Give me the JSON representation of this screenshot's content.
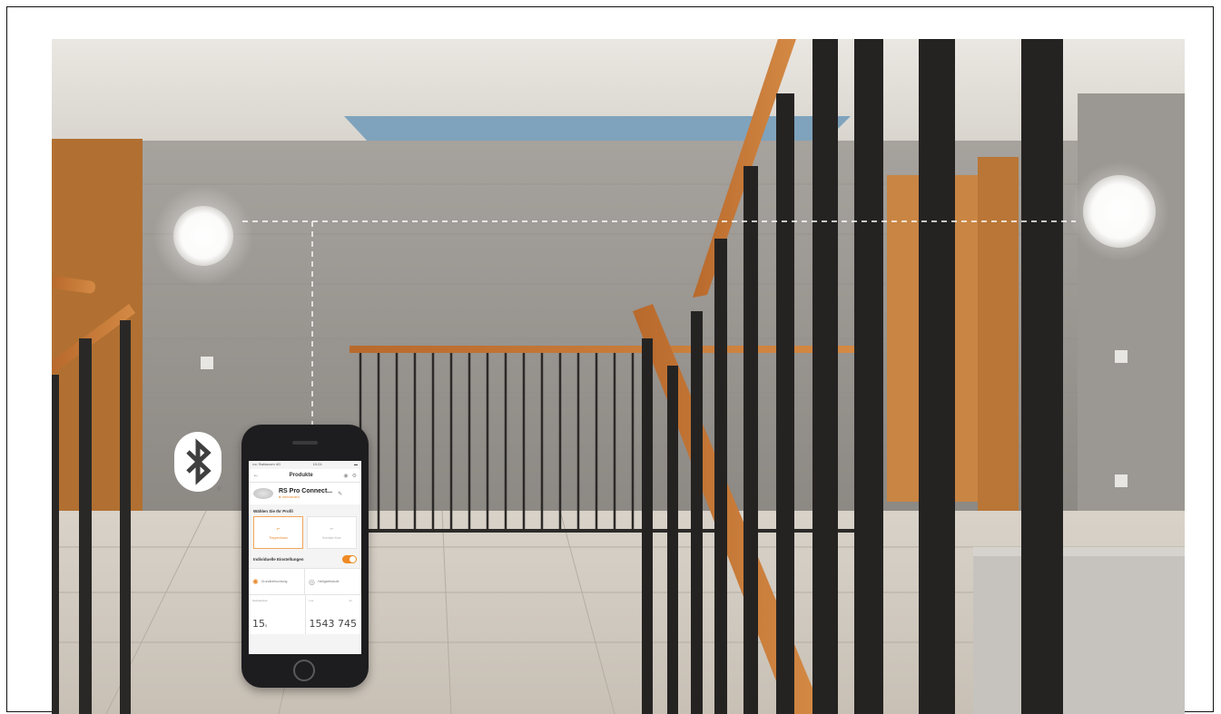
{
  "icons": {
    "bluetooth": "bluetooth-icon",
    "registered": "registered-mark"
  },
  "phone_app": {
    "status_left": "•••• Swisscom 4G",
    "status_center": "10:24",
    "nav_title": "Produkte",
    "product_name": "RS Pro Connect...",
    "product_status": "● Verbunden",
    "profile_heading": "Wählen Sie Ihr Profil",
    "profiles": [
      {
        "label": "Treppenhaus",
        "active": true
      },
      {
        "label": "Korridor Kurz",
        "active": false
      }
    ],
    "individual_settings_label": "Individuelle Einstellungen",
    "tiles": [
      {
        "label": "Grundbeleuchtung"
      },
      {
        "label": "Helligkeitsstufe"
      }
    ],
    "metrics": [
      {
        "label": "Nachlaufzeit",
        "value": "15",
        "unit": "s"
      },
      {
        "label": "Lux",
        "value": "1543",
        "label2": "lm",
        "value2": "745"
      }
    ]
  },
  "colors": {
    "accent": "#f08a24",
    "wood": "#c9833c",
    "concrete": "#9a9590"
  }
}
